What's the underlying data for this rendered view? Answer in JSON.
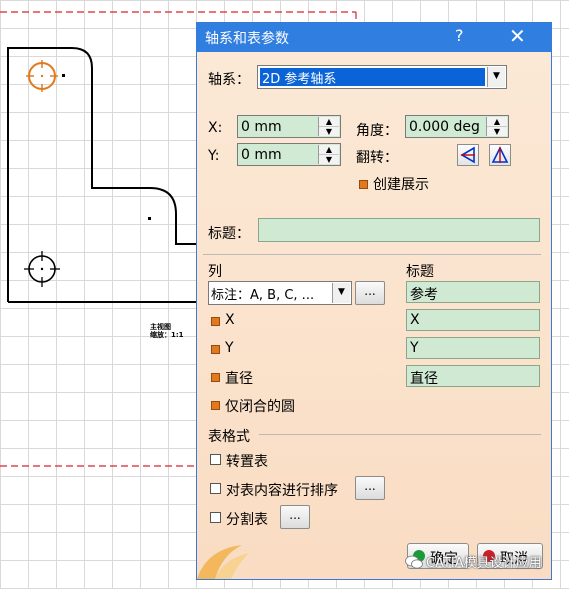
{
  "drawing": {
    "label_line1": "主视图",
    "label_line2": "缩放：1:1"
  },
  "dialog": {
    "title": "轴系和表参数",
    "help_label": "?",
    "close_label": "✕",
    "axis_label": "轴系：",
    "axis_value": "2D 参考轴系",
    "x_label": "X:",
    "x_value": "0 mm",
    "y_label": "Y:",
    "y_value": "0 mm",
    "angle_label": "角度：",
    "angle_value": "0.000 deg",
    "flip_label": "翻转：",
    "create_display_label": "创建展示",
    "title_label": "标题：",
    "title_value": "",
    "columns_header": "列",
    "titles_header": "标题",
    "column_combo_value": "标注：A, B, C, ...",
    "more_label": "...",
    "rows": [
      {
        "label": "X",
        "title": "X"
      },
      {
        "label": "Y",
        "title": "Y"
      },
      {
        "label": "直径",
        "title": "直径"
      }
    ],
    "first_title": "参考",
    "closed_circles_label": "仅闭合的圆",
    "table_format_label": "表格式",
    "transpose_label": "转置表",
    "sort_label": "对表内容进行排序",
    "split_label": "分割表",
    "ok_label": "确定",
    "cancel_label": "取消"
  },
  "watermark": "CATIA模具设计应用",
  "colors": {
    "title_bar": "#2f7ee0",
    "dialog_bg": "#fbe9d6",
    "field_green": "#cfe9d3",
    "selected_blue": "#0a64d8",
    "checkbox_orange": "#e07a1e",
    "circle_orange": "#e07a1e",
    "frame_red": "#d9232a"
  }
}
